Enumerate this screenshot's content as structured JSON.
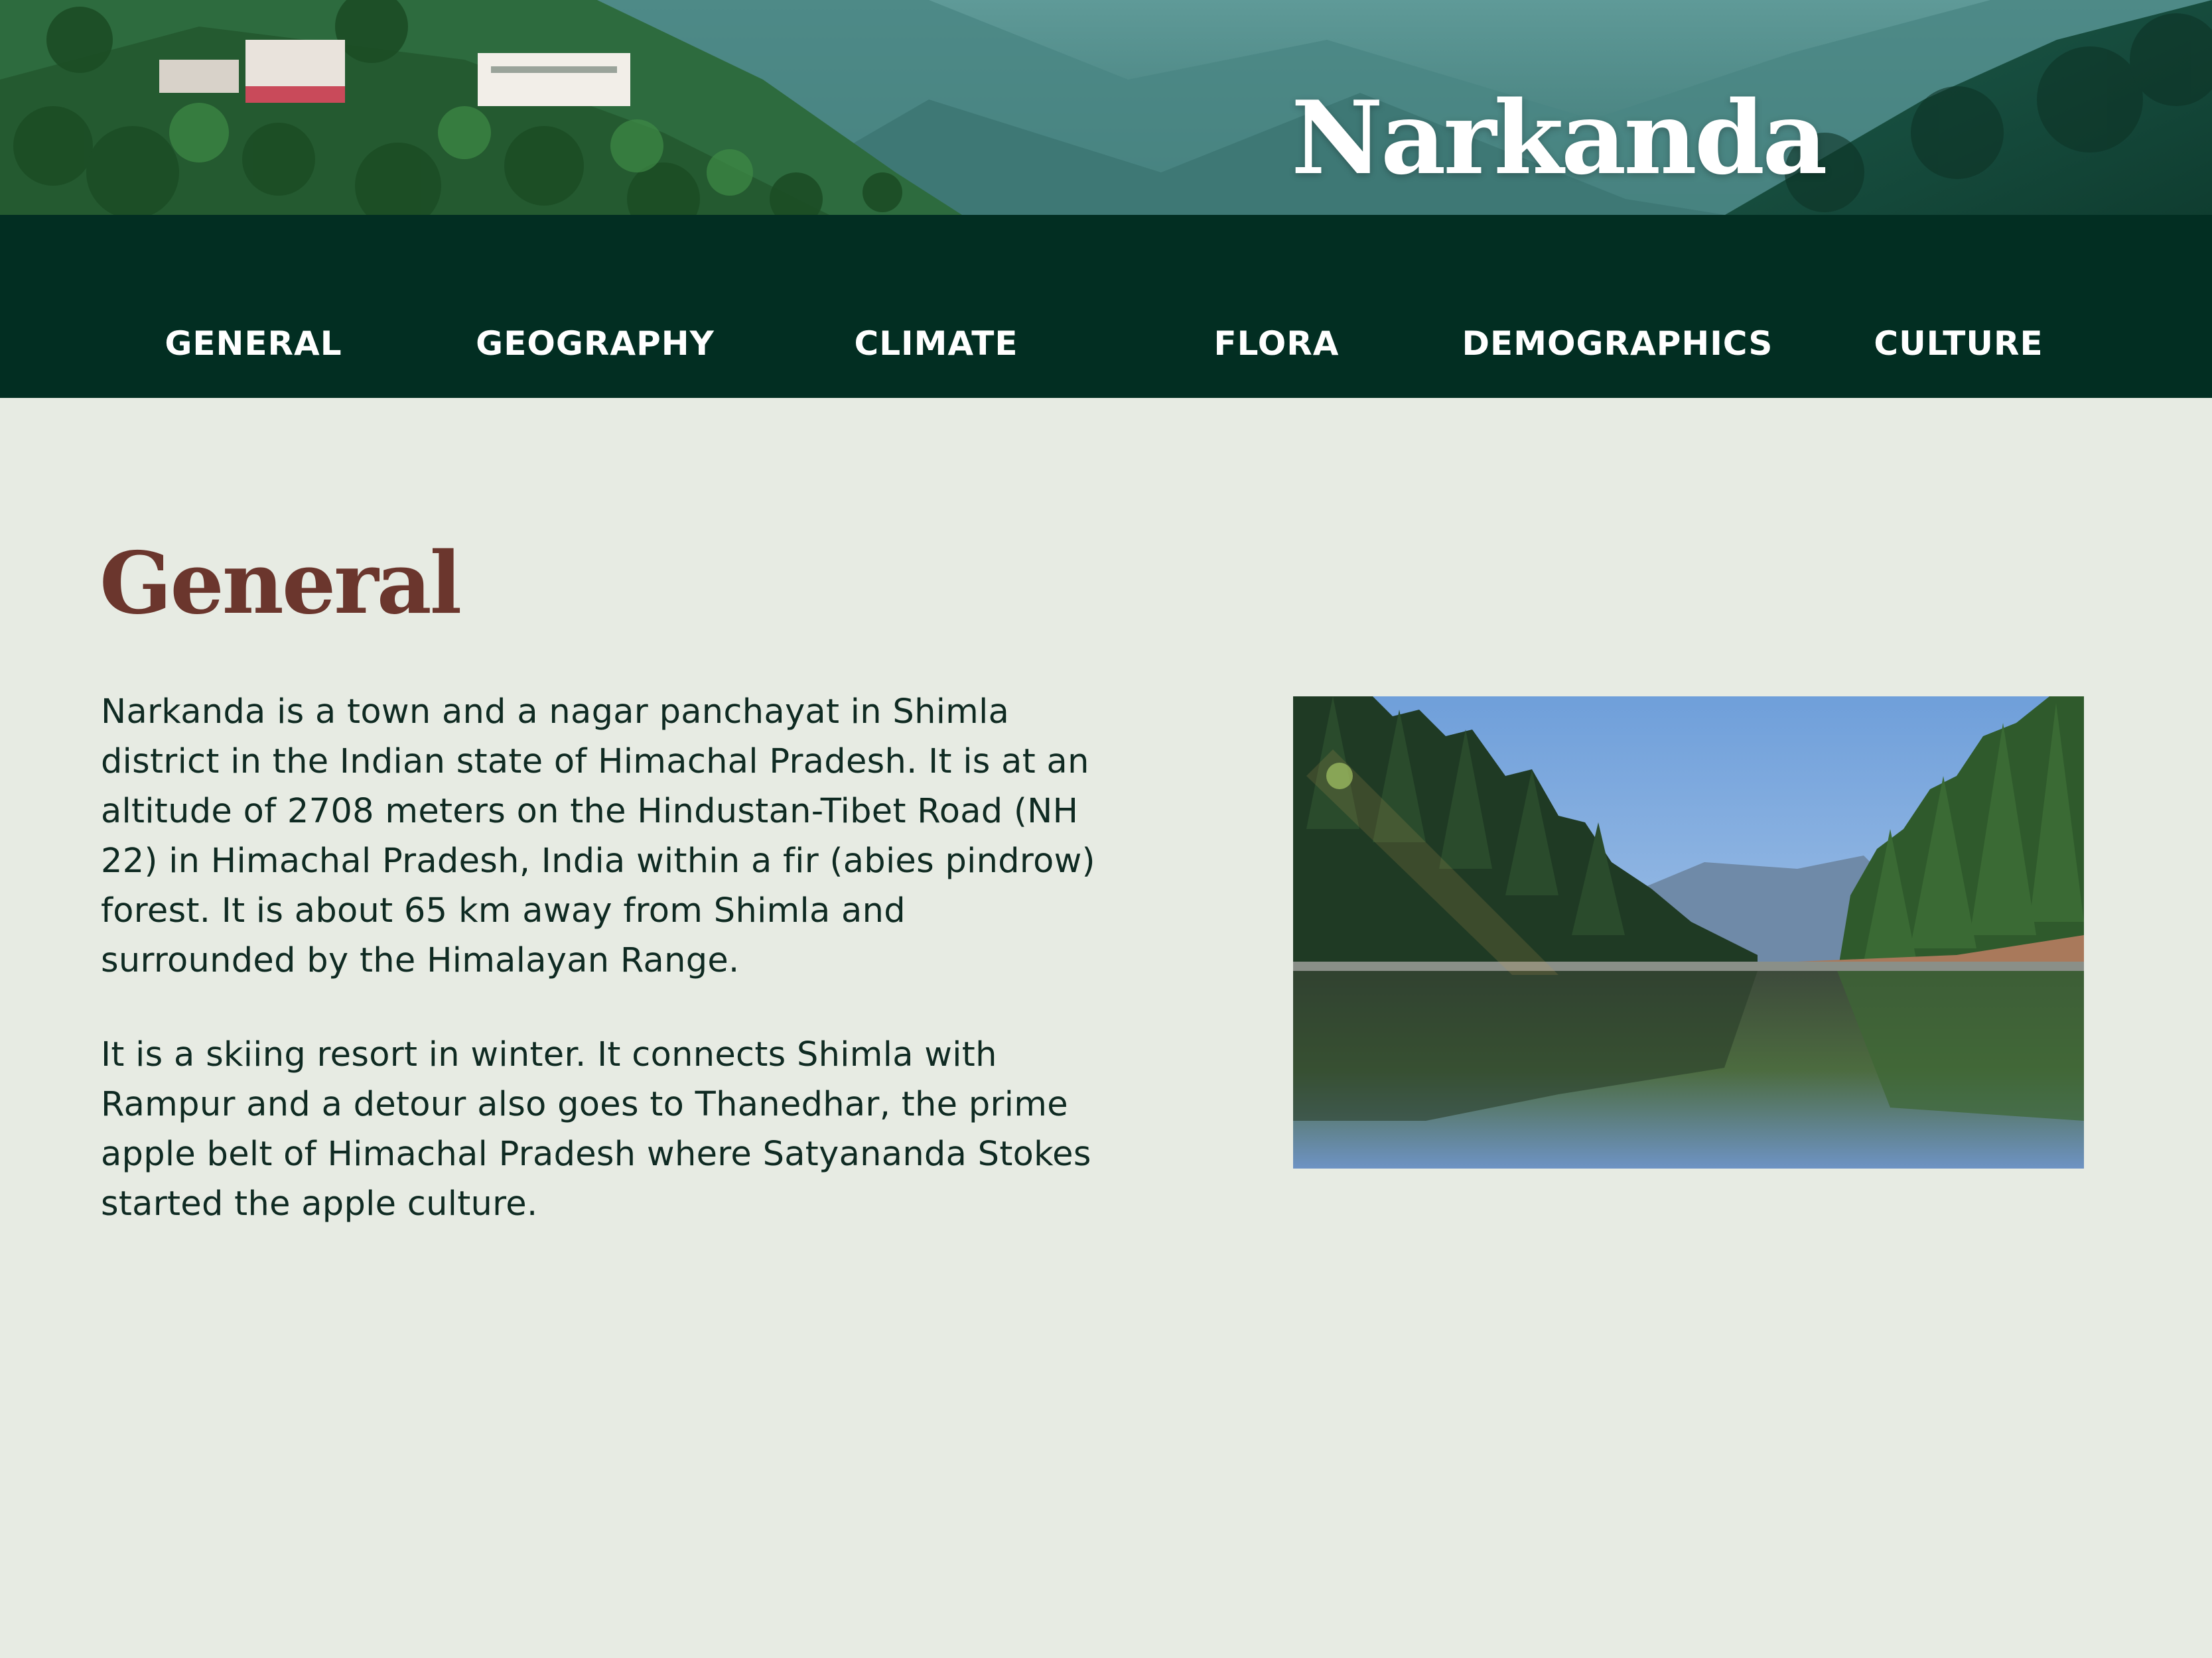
{
  "header": {
    "title": "Narkanda"
  },
  "nav": {
    "items": [
      {
        "label": "GENERAL"
      },
      {
        "label": "GEOGRAPHY"
      },
      {
        "label": "CLIMATE"
      },
      {
        "label": "FLORA"
      },
      {
        "label": "DEMOGRAPHICS"
      },
      {
        "label": "CULTURE"
      }
    ]
  },
  "main": {
    "heading": "General",
    "paragraphs": [
      "Narkanda is a town and a nagar panchayat in Shimla district in the Indian state of Himachal Pradesh. It is at an altitude of 2708 meters on the Hindustan-Tibet Road (NH 22) in Himachal Pradesh, India within a fir (abies pindrow) forest. It is about 65 km away from Shimla and surrounded by the Himalayan Range.",
      "It is a skiing resort in winter. It connects Shimla with Rampur and a detour also goes to Thanedhar, the prime apple belt of Himachal Pradesh where Satyananda Stokes started the apple culture."
    ]
  },
  "colors": {
    "page_background": "#e7ebe3",
    "nav_background": "#022e22",
    "heading": "#6b362d",
    "body_text": "#0f2a22"
  }
}
